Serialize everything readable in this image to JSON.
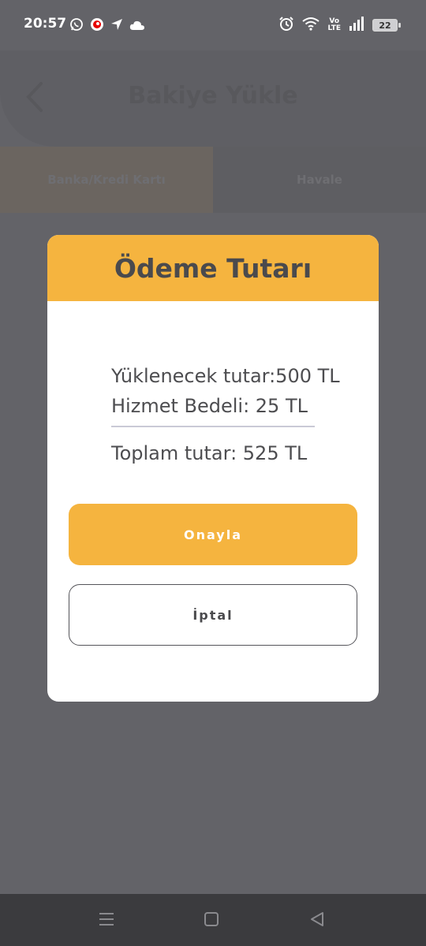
{
  "status_bar": {
    "time": "20:57",
    "left_icons": [
      "whatsapp-icon",
      "vodafone-icon",
      "location-arrow-icon",
      "cloud-icon"
    ],
    "right_icons": [
      "alarm-icon",
      "wifi-icon",
      "volte-icon",
      "signal-icon",
      "battery-icon"
    ],
    "volte_top": "Vo",
    "volte_bottom": "LTE",
    "battery_level": "22"
  },
  "app": {
    "title": "Bakiye Yükle",
    "back_icon": "chevron-left-icon",
    "tabs": [
      {
        "label": "Banka/Kredi Kartı",
        "active": true
      },
      {
        "label": "Havale",
        "active": false
      }
    ]
  },
  "dialog": {
    "title": "Ödeme Tutarı",
    "load_amount": "Yüklenecek tutar:500 TL",
    "service_fee": "Hizmet Bedeli:  25 TL",
    "total": "Toplam tutar:  525 TL",
    "confirm_label": "Onayla",
    "cancel_label": "İptal"
  },
  "colors": {
    "accent": "#f5b43f",
    "overlay": "#636368",
    "text_dark": "#4a4a4d"
  },
  "nav_bar": {
    "icons": [
      "menu-icon",
      "home-square-icon",
      "back-triangle-icon"
    ]
  }
}
